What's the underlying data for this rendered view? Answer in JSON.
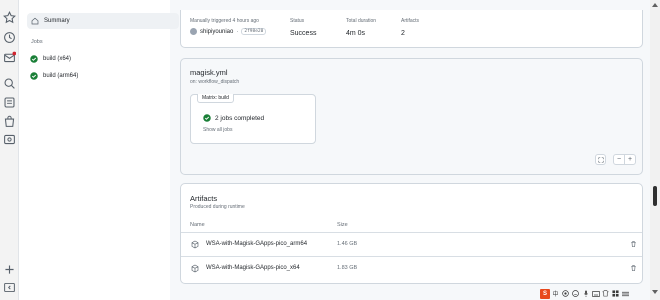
{
  "sidebar": {
    "summary_label": "Summary",
    "jobs_heading": "Jobs",
    "jobs": [
      {
        "label": "build (x64)"
      },
      {
        "label": "build (arm64)"
      }
    ]
  },
  "run_meta": {
    "trigger_label": "Manually triggered 4 hours ago",
    "actor": "shipiyouniao",
    "commit": "2f98e20",
    "status_label": "Status",
    "status_value": "Success",
    "duration_label": "Total duration",
    "duration_value": "4m 0s",
    "artifacts_label": "Artifacts",
    "artifacts_value": "2"
  },
  "workflow": {
    "name": "magisk.yml",
    "trigger": "on: workflow_dispatch",
    "matrix_label": "Matrix: build",
    "jobs_completed": "2 jobs completed",
    "show_all": "Show all jobs",
    "zoom_minus": "−",
    "zoom_plus": "+"
  },
  "artifacts": {
    "title": "Artifacts",
    "subtitle": "Produced during runtime",
    "col_name": "Name",
    "col_size": "Size",
    "rows": [
      {
        "name": "WSA-with-Magisk-GApps-pico_arm64",
        "size": "1.46 GB"
      },
      {
        "name": "WSA-with-Magisk-GApps-pico_x64",
        "size": "1.83 GB"
      }
    ]
  },
  "taskbar": {
    "ime_label": "中",
    "ime_icon": "S"
  },
  "colors": {
    "success": "#1a7f37",
    "accent": "#0969da",
    "ime_brand": "#e8481c"
  }
}
